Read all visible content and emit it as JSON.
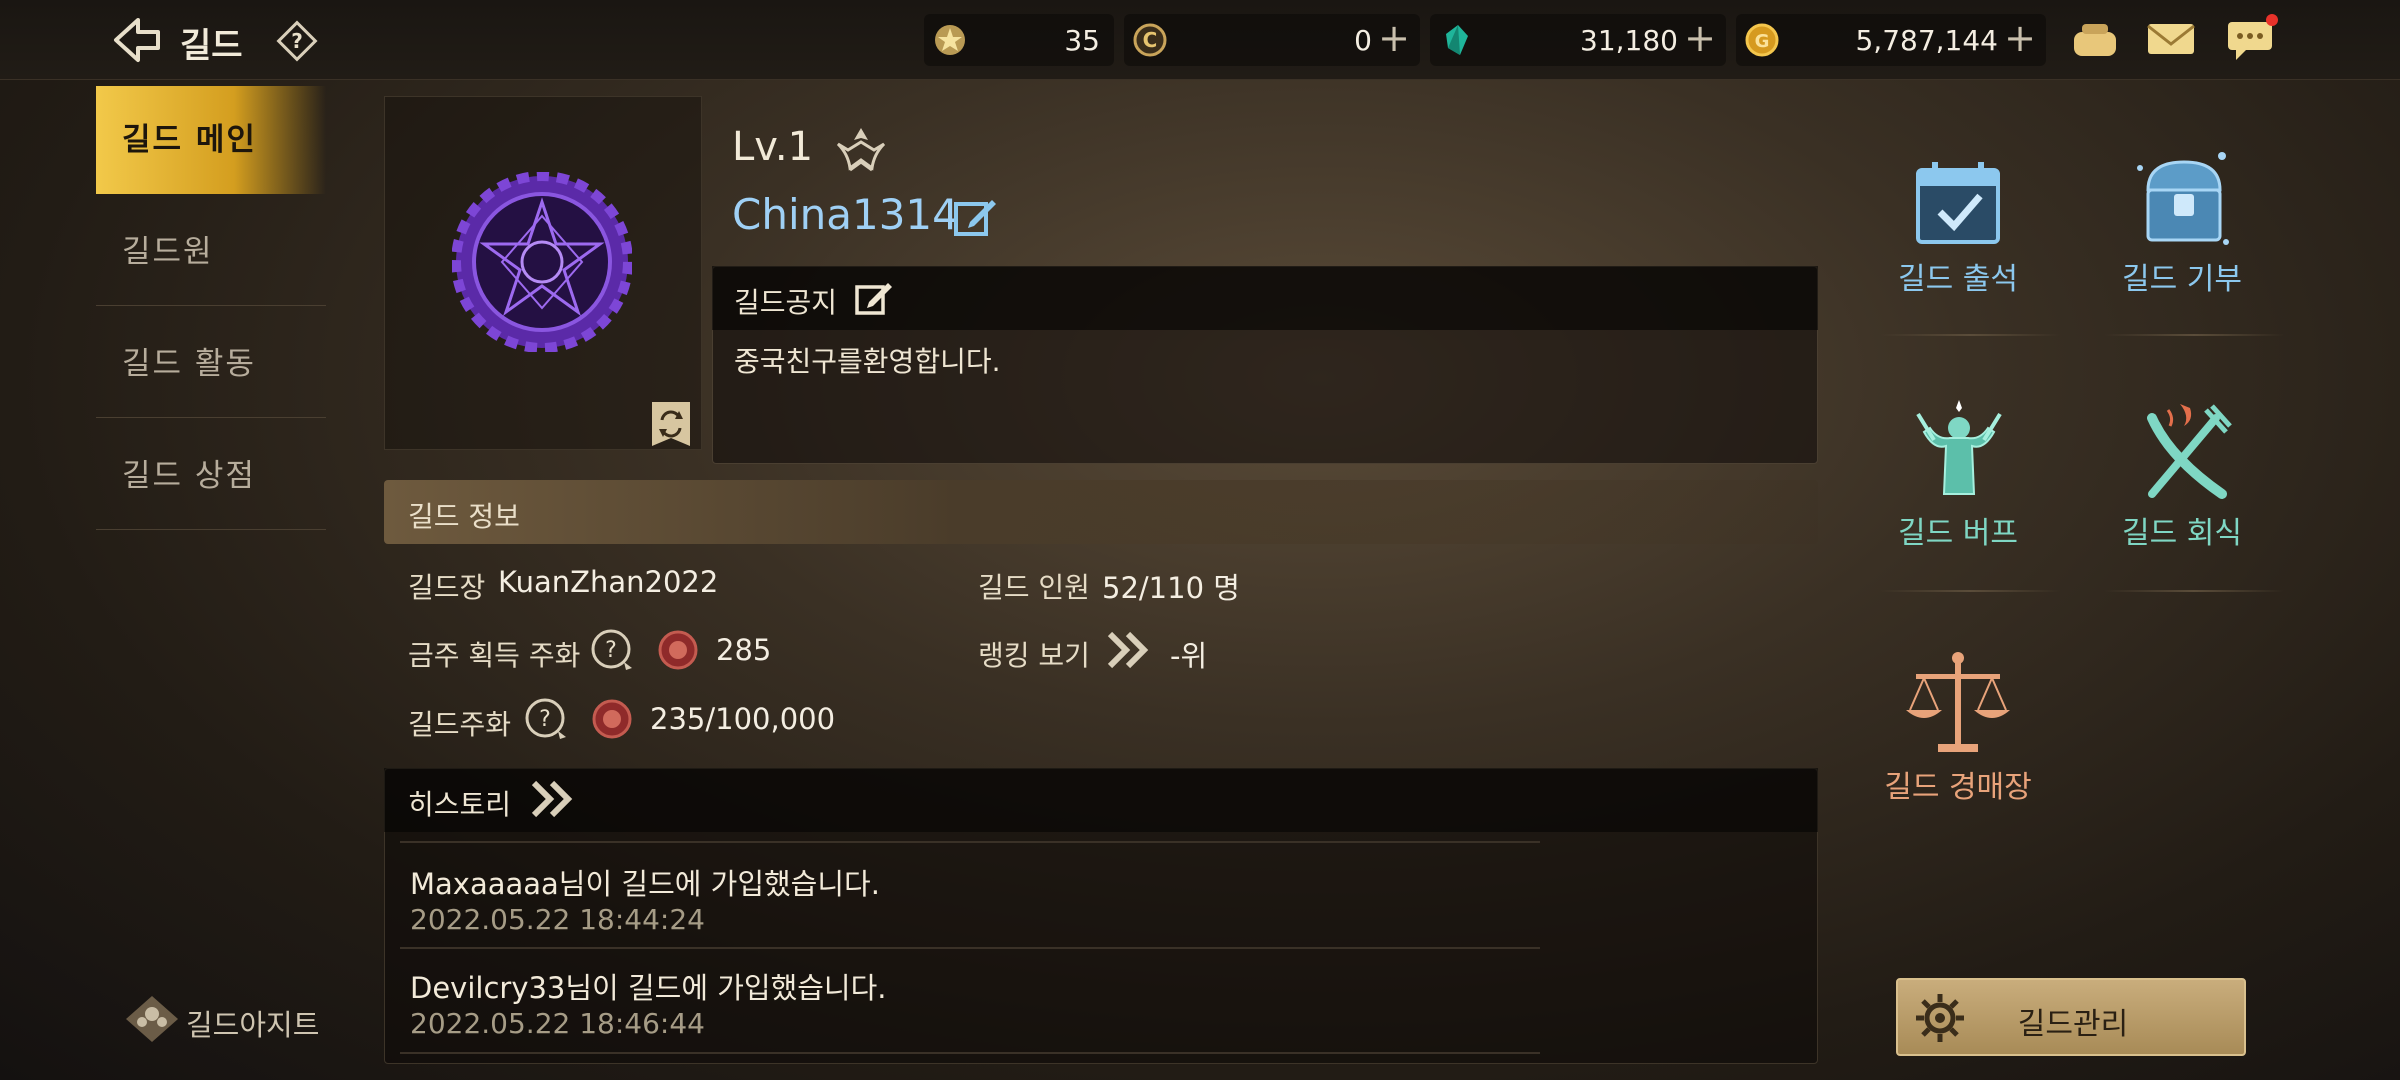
{
  "header": {
    "title": "길드",
    "resources": [
      {
        "icon": "star-medal-icon",
        "value": "35",
        "has_plus": false
      },
      {
        "icon": "c-coin-icon",
        "value": "0",
        "has_plus": true
      },
      {
        "icon": "green-gem-icon",
        "value": "31,180",
        "has_plus": true
      },
      {
        "icon": "gold-coin-icon",
        "value": "5,787,144",
        "has_plus": true
      }
    ],
    "plus_glyph": "+"
  },
  "sidebar": {
    "items": [
      {
        "label": "길드 메인",
        "active": true
      },
      {
        "label": "길드원",
        "active": false
      },
      {
        "label": "길드 활동",
        "active": false
      },
      {
        "label": "길드 상점",
        "active": false
      }
    ],
    "hideout_label": "길드아지트"
  },
  "guild": {
    "level": "Lv.1",
    "name": "China1314",
    "notice_title": "길드공지",
    "notice_text": "중국친구를환영합니다."
  },
  "info": {
    "section_title": "길드 정보",
    "leader_label": "길드장",
    "leader_value": "KuanZhan2022",
    "members_label": "길드 인원",
    "members_value": "52/110 명",
    "weekly_coin_label": "금주 획득 주화",
    "weekly_coin_value": "285",
    "ranking_label": "랭킹 보기",
    "ranking_value": "-위",
    "guild_coin_label": "길드주화",
    "guild_coin_value": "235/100,000"
  },
  "history": {
    "title": "히스토리",
    "entries": [
      {
        "message": "Maxaaaaa님이 길드에 가입했습니다.",
        "time": "2022.05.22 18:44:24"
      },
      {
        "message": "Devilcry33님이 길드에 가입했습니다.",
        "time": "2022.05.22 18:46:44"
      }
    ]
  },
  "features": {
    "attendance": "길드 출석",
    "donation": "길드 기부",
    "buff": "길드 버프",
    "dinner": "길드 회식",
    "auction": "길드 경매장",
    "manage_button": "길드관리"
  },
  "colors": {
    "accent_gold": "#e5b431",
    "feature_blue": "#8cc8ee",
    "feature_teal": "#7fd7c4",
    "feature_orange": "#e8a37a"
  }
}
